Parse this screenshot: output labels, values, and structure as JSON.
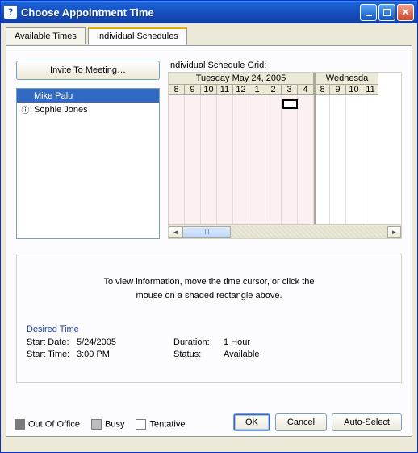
{
  "window": {
    "title": "Choose Appointment Time",
    "icon_glyph": "?"
  },
  "tabs": {
    "available": "Available Times",
    "individual": "Individual Schedules"
  },
  "invite_label": "Invite To Meeting…",
  "people": [
    {
      "name": "Mike Palu",
      "selected": true,
      "icon": ""
    },
    {
      "name": "Sophie Jones",
      "selected": false,
      "icon": "ⓘ"
    }
  ],
  "grid": {
    "caption": "Individual Schedule Grid:",
    "days": [
      "Tuesday May 24, 2005",
      "Wednesda"
    ],
    "hours_day1": [
      "8",
      "9",
      "10",
      "11",
      "12",
      "1",
      "2",
      "3",
      "4"
    ],
    "hours_day2": [
      "8",
      "9",
      "10",
      "11"
    ],
    "selected_hour_index": 7
  },
  "info": {
    "line1": "To view information, move the time cursor, or click the",
    "line2": "mouse on a shaded rectangle above."
  },
  "desired": {
    "title": "Desired Time",
    "start_date_label": "Start Date:",
    "start_date_value": "5/24/2005",
    "start_time_label": "Start Time:",
    "start_time_value": "3:00 PM",
    "duration_label": "Duration:",
    "duration_value": "1 Hour",
    "status_label": "Status:",
    "status_value": "Available"
  },
  "legend": {
    "out": "Out Of Office",
    "busy": "Busy",
    "tentative": "Tentative"
  },
  "buttons": {
    "ok": "OK",
    "cancel": "Cancel",
    "auto": "Auto-Select"
  }
}
